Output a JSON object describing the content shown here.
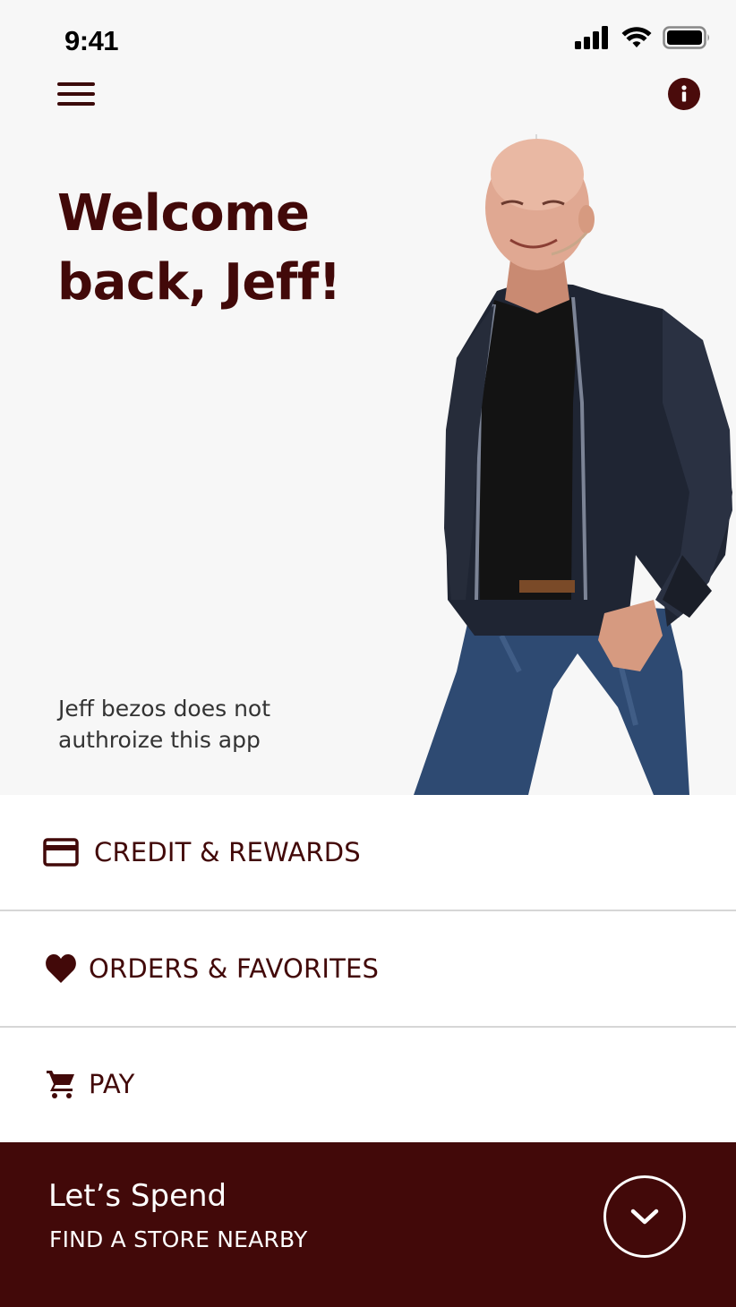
{
  "status_bar": {
    "time": "9:41",
    "icons": [
      "signal-icon",
      "wifi-icon",
      "battery-icon"
    ]
  },
  "header": {
    "menu_icon": "hamburger-menu-icon",
    "info_icon": "info-icon"
  },
  "hero": {
    "welcome_line1": "Welcome",
    "welcome_line2": "back, Jeff!",
    "disclaimer_line1": "Jeff bezos does not",
    "disclaimer_line2": "authroize this app"
  },
  "menu": {
    "items": [
      {
        "label": "CREDIT & REWARDS",
        "icon": "credit-card-icon"
      },
      {
        "label": "ORDERS & FAVORITES",
        "icon": "heart-icon"
      },
      {
        "label": "PAY",
        "icon": "shopping-cart-icon"
      }
    ]
  },
  "bottom_bar": {
    "title": "Let’s Spend",
    "subtitle": "FIND A STORE NEARBY",
    "action_icon": "chevron-down-icon"
  },
  "colors": {
    "brand": "#420909",
    "background": "#f7f7f7",
    "surface": "#ffffff",
    "divider": "#d6d6d6"
  }
}
